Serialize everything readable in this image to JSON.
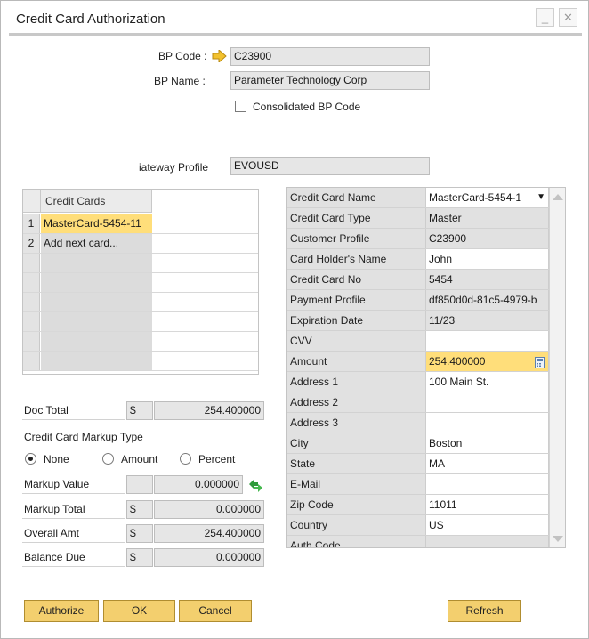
{
  "window": {
    "title": "Credit Card Authorization",
    "minimize_label": "_",
    "close_label": "✕"
  },
  "header": {
    "bp_code_label": "BP Code :",
    "bp_code_value": "C23900",
    "bp_name_label": "BP Name :",
    "bp_name_value": "Parameter Technology Corp",
    "consolidated_label": "Consolidated BP Code",
    "gateway_label": "iateway Profile",
    "gateway_value": "EVOUSD"
  },
  "cards_grid": {
    "header": "Credit Cards",
    "rows": [
      {
        "num": "1",
        "label": "MasterCard-5454-11"
      },
      {
        "num": "2",
        "label": "Add next card..."
      }
    ]
  },
  "details": {
    "dropdown_arrow": "▼",
    "rows": [
      {
        "label": "Credit Card Name",
        "value": "MasterCard-5454-1"
      },
      {
        "label": "Credit Card Type",
        "value": "Master"
      },
      {
        "label": "Customer Profile",
        "value": "C23900"
      },
      {
        "label": "Card Holder's Name",
        "value": "John"
      },
      {
        "label": "Credit Card No",
        "value": "5454"
      },
      {
        "label": "Payment Profile",
        "value": "df850d0d-81c5-4979-b"
      },
      {
        "label": "Expiration Date",
        "value": "11/23"
      },
      {
        "label": "CVV",
        "value": ""
      },
      {
        "label": "Amount",
        "value": "254.400000"
      },
      {
        "label": "Address 1",
        "value": "100 Main St."
      },
      {
        "label": "Address 2",
        "value": ""
      },
      {
        "label": "Address 3",
        "value": ""
      },
      {
        "label": "City",
        "value": "Boston"
      },
      {
        "label": "State",
        "value": "MA"
      },
      {
        "label": "E-Mail",
        "value": ""
      },
      {
        "label": "Zip Code",
        "value": "11011"
      },
      {
        "label": "Country",
        "value": "US"
      },
      {
        "label": "Auth Code",
        "value": ""
      }
    ]
  },
  "totals": {
    "doc_total_label": "Doc Total",
    "currency": "$",
    "doc_total_value": "254.400000",
    "markup_type_label": "Credit Card Markup Type",
    "radio_none": "None",
    "radio_amount": "Amount",
    "radio_percent": "Percent",
    "markup_value_label": "Markup Value",
    "markup_value": "0.000000",
    "markup_total_label": "Markup Total",
    "markup_total_value": "0.000000",
    "overall_label": "Overall Amt",
    "overall_value": "254.400000",
    "balance_label": "Balance Due",
    "balance_value": "0.000000"
  },
  "buttons": {
    "authorize": "Authorize",
    "ok": "OK",
    "cancel": "Cancel",
    "refresh": "Refresh"
  },
  "colors": {
    "accent_yellow": "#f3cf6e",
    "selected_cell": "#ffde7a",
    "link_arrow": "#e3b21b"
  }
}
